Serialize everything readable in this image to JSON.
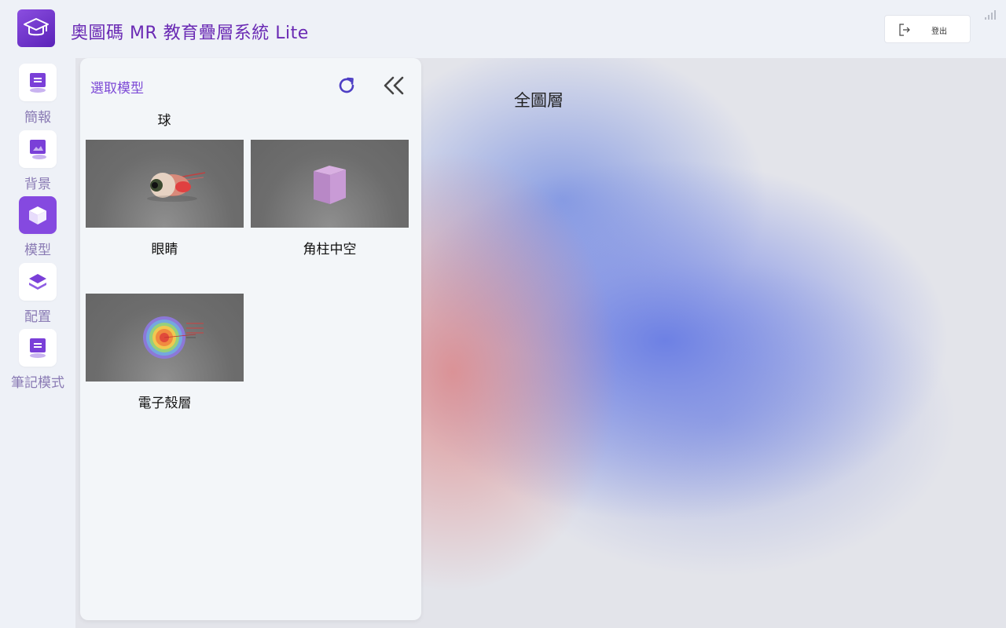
{
  "header": {
    "app_title": "奧圖碼 MR 教育疊層系統 Lite",
    "logout_label": "登出"
  },
  "nav": {
    "items": [
      {
        "label": "簡報",
        "icon": "slides-icon",
        "active": false
      },
      {
        "label": "背景",
        "icon": "image-icon",
        "active": false
      },
      {
        "label": "模型",
        "icon": "cube-icon",
        "active": true
      },
      {
        "label": "配置",
        "icon": "layers-icon",
        "active": false
      },
      {
        "label": "筆記模式",
        "icon": "note-icon",
        "active": false
      }
    ]
  },
  "panel": {
    "title": "選取模型",
    "category": "球",
    "models": [
      {
        "name": "眼睛",
        "thumb": "eye-model-thumbnail"
      },
      {
        "name": "角柱中空",
        "thumb": "prism-model-thumbnail"
      },
      {
        "name": "電子殼層",
        "thumb": "electron-shell-model-thumbnail"
      }
    ]
  },
  "viewport": {
    "label": "全圖層"
  },
  "colors": {
    "accent": "#8549e0",
    "title": "#6a2ab4",
    "panel_title": "#7d4ad6"
  }
}
